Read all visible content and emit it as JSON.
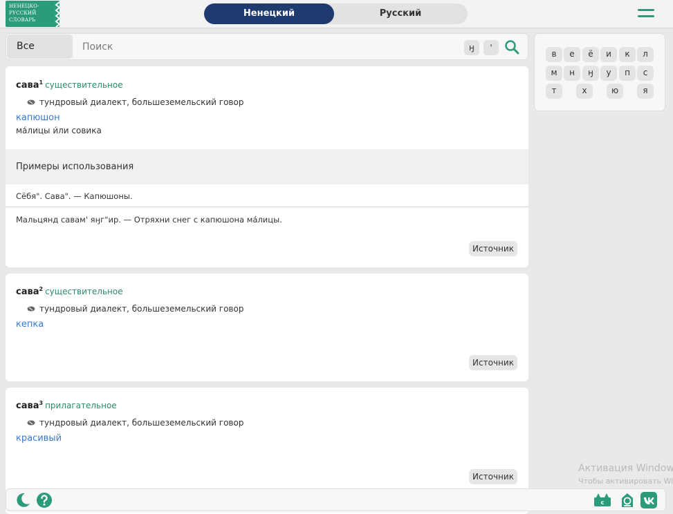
{
  "header": {
    "logo_lines": [
      "НЕНЕЦКО-",
      "РУССКИЙ",
      "СЛОВАРЬ"
    ],
    "lang_tabs": [
      "Ненецкий",
      "Русский"
    ],
    "active_tab": "Ненецкий"
  },
  "search": {
    "filter_label": "Все",
    "placeholder": "Поиск",
    "value": "",
    "special_chars": [
      "ӈ",
      "'"
    ]
  },
  "alphabet": [
    "в",
    "е",
    "ё",
    "и",
    "к",
    "л",
    "м",
    "н",
    "ӈ",
    "у",
    "п",
    "с",
    "т",
    "х",
    "ю",
    "я"
  ],
  "entries": [
    {
      "word": "сава",
      "sup": "1",
      "pos": "существительное",
      "dialect": "тундровый диалект, большеземельский говор",
      "translation": "капюшон",
      "note": "ма́лицы и́ли совика",
      "examples_title": "Примеры использования",
      "examples": [
        "Сёбя\". Сава\". — Капюшоны.",
        "Мальцянд савам' яӈг\"ир. — Отряхни снег с капюшона ма́лицы."
      ],
      "source_label": "Источник"
    },
    {
      "word": "сава",
      "sup": "2",
      "pos": "существительное",
      "dialect": "тундровый диалект, большеземельский говор",
      "translation": "кепка",
      "source_label": "Источник"
    },
    {
      "word": "сава",
      "sup": "3",
      "pos": "прилагательное",
      "dialect": "тундровый диалект, большеземельский говор",
      "translation": "красивый",
      "source_label": "Источник"
    }
  ],
  "footer": {
    "icons": [
      "moon-icon",
      "help-icon",
      "cattle-icon",
      "emblem-icon",
      "vk-icon"
    ]
  },
  "watermark": {
    "title": "Активация Windows",
    "subtitle": "Чтобы активировать Windows"
  },
  "colors": {
    "brand_green": "#2b9b7c",
    "nav_blue": "#1f3a6e",
    "link_blue": "#3a78c9",
    "pos_green": "#2b8a6e"
  }
}
